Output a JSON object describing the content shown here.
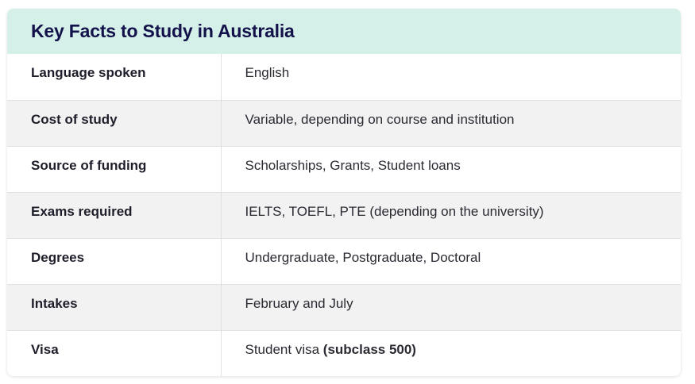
{
  "title": "Key Facts to Study in Australia",
  "rows": [
    {
      "label": "Language spoken",
      "value": "English"
    },
    {
      "label": "Cost of study",
      "value": "Variable, depending on course and institution"
    },
    {
      "label": "Source of funding",
      "value": "Scholarships, Grants, Student loans"
    },
    {
      "label": "Exams required",
      "value": "IELTS, TOEFL, PTE (depending on the university)"
    },
    {
      "label": "Degrees",
      "value": "Undergraduate, Postgraduate, Doctoral"
    },
    {
      "label": "Intakes",
      "value": "February and July"
    },
    {
      "label": "Visa",
      "value": "Student visa",
      "value_strong": "(subclass 500)"
    }
  ],
  "colors": {
    "header_bg": "#d4f0e8",
    "title": "#13114a",
    "alt_row_bg": "#f2f2f2",
    "divider": "#e1e1e1"
  }
}
